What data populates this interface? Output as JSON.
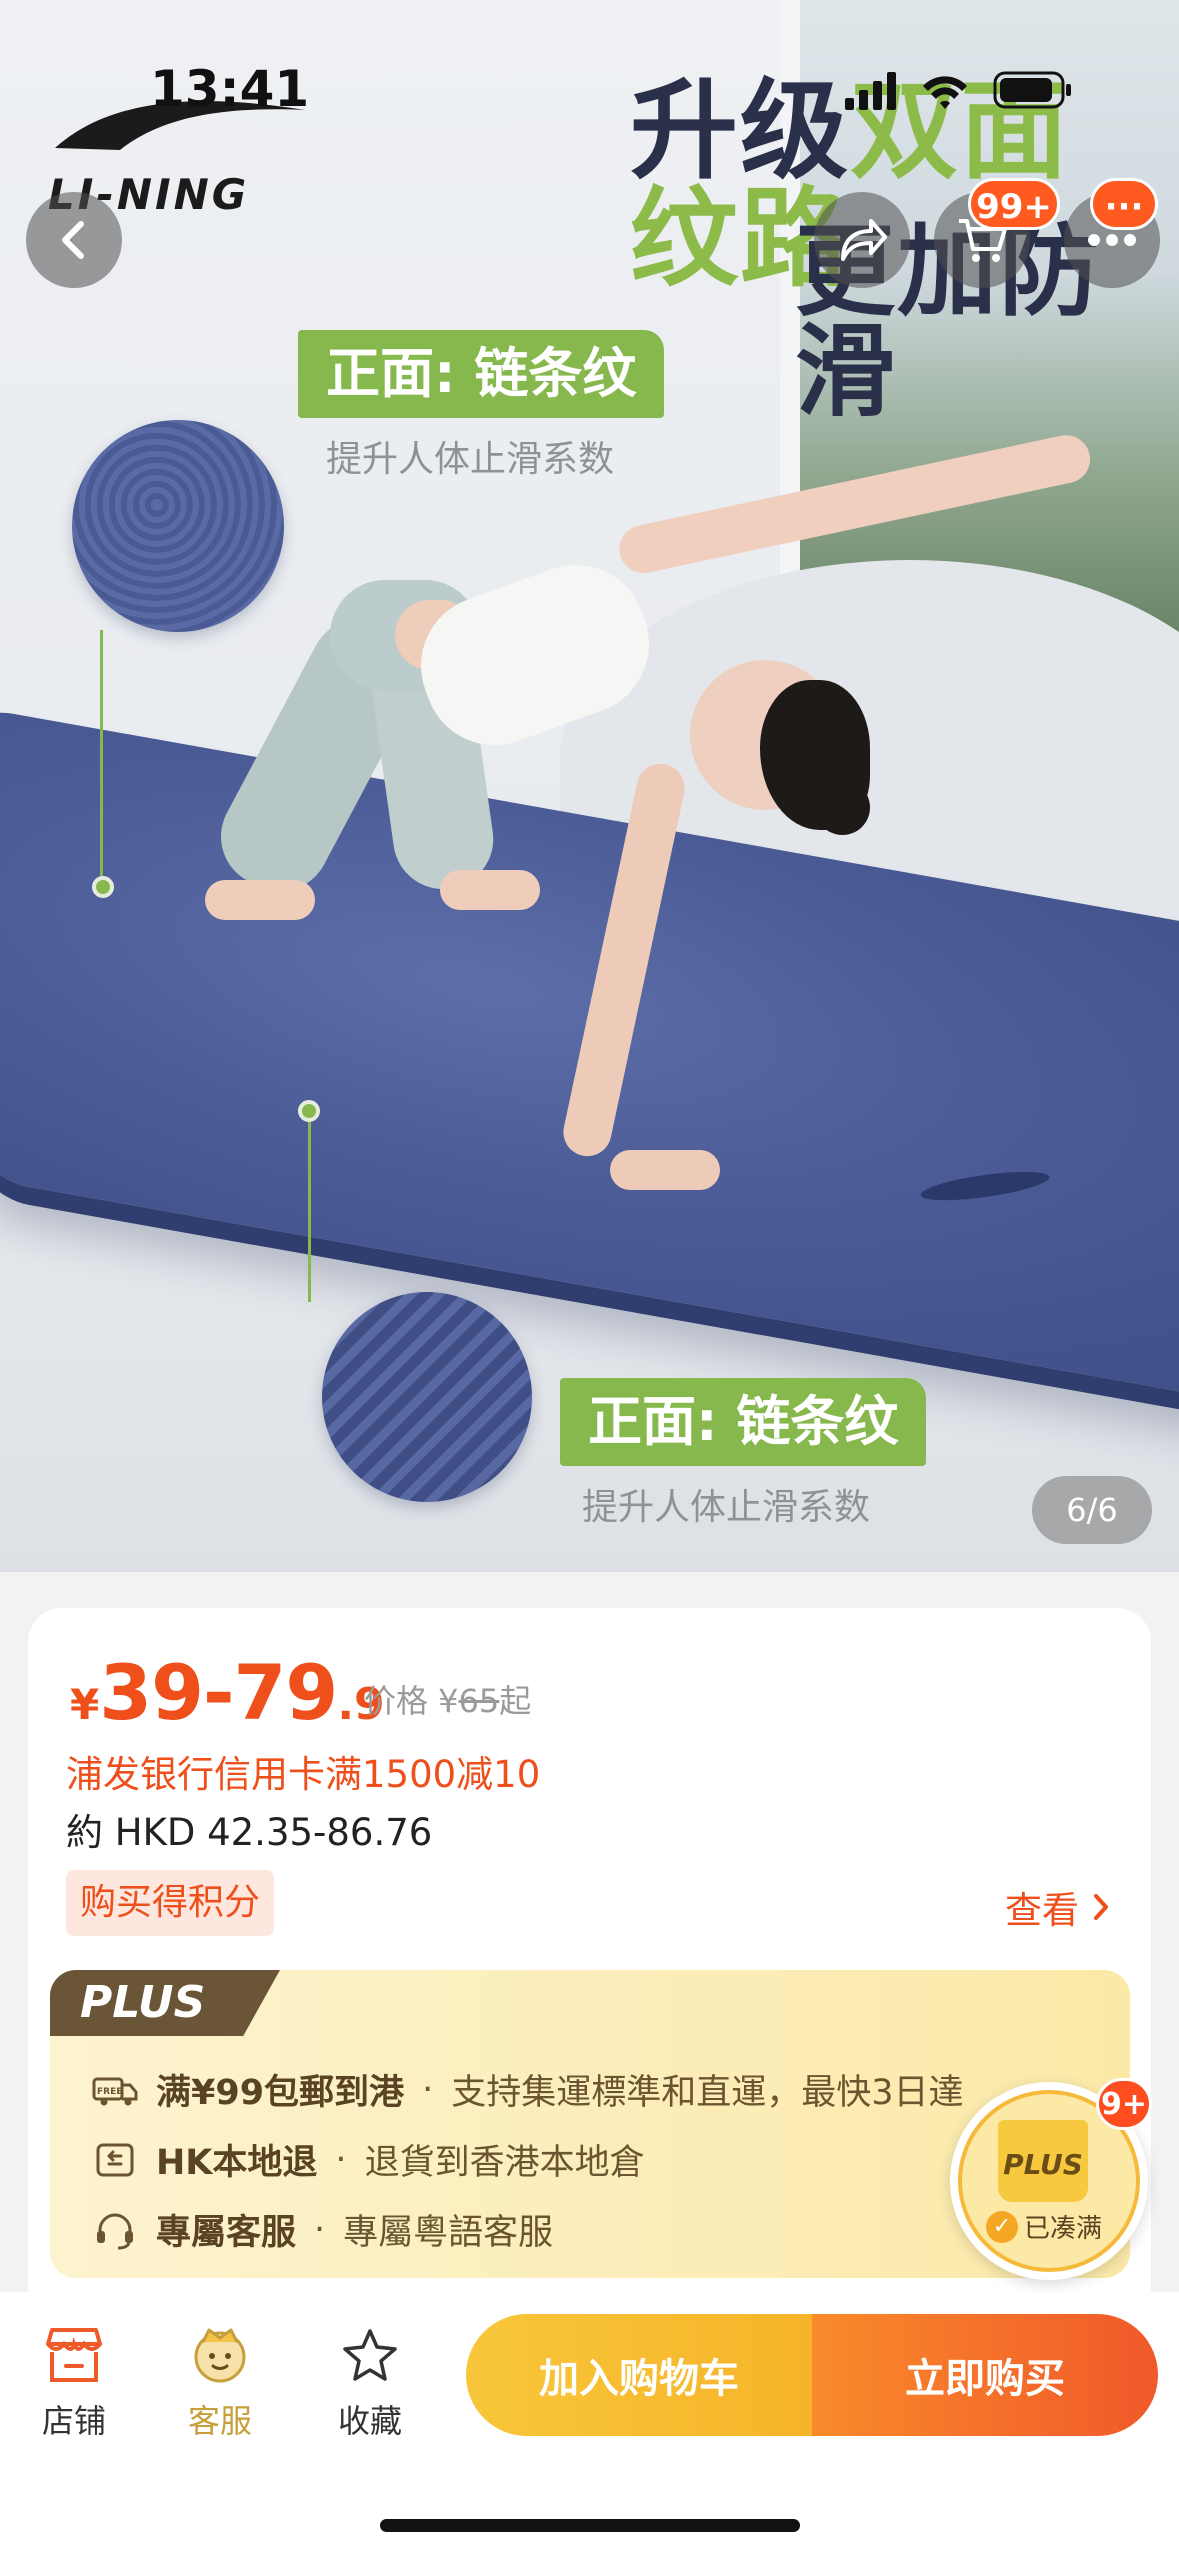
{
  "status_bar": {
    "time": "13:41"
  },
  "header": {
    "cart_badge": "99+",
    "more_badge": "···"
  },
  "hero": {
    "brand": "LI-NING",
    "headline_line1_a": "升级",
    "headline_line1_b": "双面纹路",
    "headline_line2": "更加防滑",
    "top_tag": "正面: 链条纹",
    "top_sub": "提升人体止滑系数",
    "bottom_tag": "正面: 链条纹",
    "bottom_sub": "提升人体止滑系数",
    "pager": "6/6"
  },
  "product": {
    "currency": "¥",
    "price_main": "39-79",
    "price_decimal": ".9",
    "original_label": "价格 ¥",
    "original_value": "65",
    "original_suffix": "起",
    "promo": "浦发银行信用卡满1500减10",
    "hkd": "約 HKD 42.35-86.76",
    "points_tag": "购买得积分",
    "view_label": "查看"
  },
  "plus": {
    "label": "PLUS",
    "rows": [
      {
        "icon": "free-shipping-icon",
        "strong": "满¥99包郵到港",
        "text": "支持集運標準和直運，最快3日達"
      },
      {
        "icon": "return-icon",
        "strong": "HK本地退",
        "text": "退貨到香港本地倉"
      },
      {
        "icon": "headset-icon",
        "strong": "專屬客服",
        "text": "專屬粵語客服"
      }
    ]
  },
  "floating_badge": {
    "count": "9+",
    "bag_label": "PLUS",
    "status": "已凑满"
  },
  "bottom_bar": {
    "store": "店铺",
    "service": "客服",
    "favorite": "收藏",
    "add_to_cart": "加入购物车",
    "buy_now": "立即购买"
  },
  "colors": {
    "accent": "#ee4f1b",
    "green_tag": "#86b84e",
    "mat_blue": "#4a5b96",
    "plus_brown": "#6a5636"
  }
}
